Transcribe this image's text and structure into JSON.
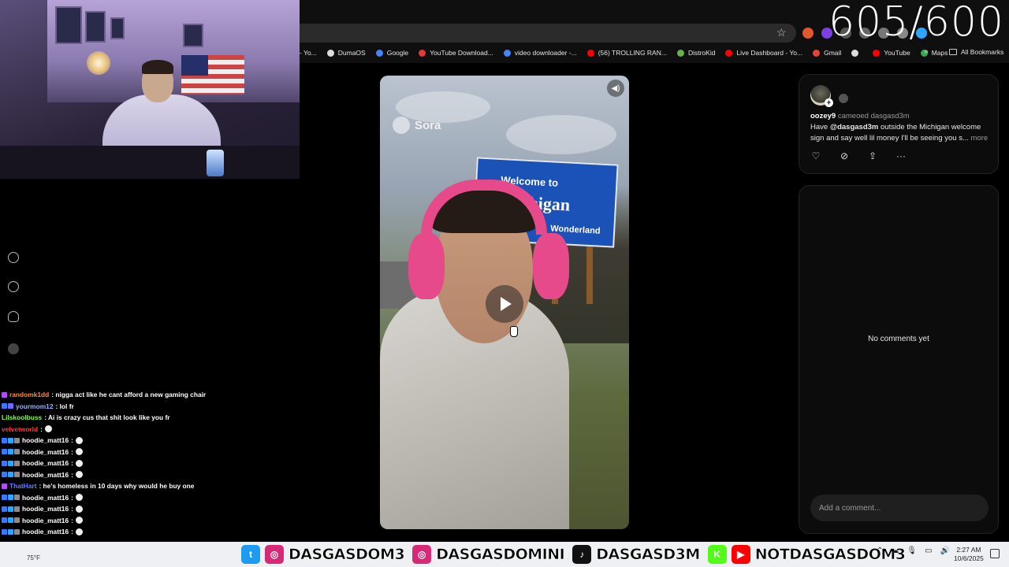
{
  "counter": "605/600",
  "bookmarks": [
    {
      "label": "- Yo...",
      "icon": "youtube-icon",
      "color": "#ff0000"
    },
    {
      "label": "DumaOS",
      "icon": "globe-icon",
      "color": "#dddddd"
    },
    {
      "label": "Google",
      "icon": "google-icon",
      "color": "#4285f4"
    },
    {
      "label": "YouTube Download...",
      "icon": "download-icon",
      "color": "#e53935"
    },
    {
      "label": "video downloader -...",
      "icon": "google-icon",
      "color": "#4285f4"
    },
    {
      "label": "(56) TROLLING RAN...",
      "icon": "youtube-icon",
      "color": "#ff0000"
    },
    {
      "label": "DistroKid",
      "icon": "distrokid-icon",
      "color": "#6ab04c"
    },
    {
      "label": "Live Dashboard - Yo...",
      "icon": "youtube-icon",
      "color": "#ff0000"
    },
    {
      "label": "Gmail",
      "icon": "gmail-icon",
      "color": "#ea4335"
    },
    {
      "label": "",
      "icon": "globe-icon",
      "color": "#dddddd"
    },
    {
      "label": "YouTube",
      "icon": "youtube-icon",
      "color": "#ff0000"
    },
    {
      "label": "Maps",
      "icon": "maps-icon",
      "color": "#34a853"
    }
  ],
  "bookmarks_more": "»",
  "all_bookmarks": "All Bookmarks",
  "video": {
    "watermark": "Sora",
    "sign_line1": "Welcome to",
    "sign_line2": "Michigan",
    "sign_line3": "Wonderland"
  },
  "post": {
    "username": "oozey9",
    "action": "cameoed dasgasd3m",
    "caption_mention": "@dasgasd3m",
    "caption_pre": "Have ",
    "caption_post": " outside the Michigan welcome sign and say well lil money I'll be seeing you s...",
    "more": "more"
  },
  "comments": {
    "empty": "No comments yet",
    "placeholder": "Add a comment..."
  },
  "chat": [
    {
      "user": "randomk1dd",
      "color": "#ff8a3d",
      "text": ": nigga act like he cant afford a new gaming chair",
      "badges": [
        "#b14ef5"
      ]
    },
    {
      "user": "yourmom12",
      "color": "#8fb4ff",
      "text": ": lol fr",
      "badges": [
        "#3b78ff",
        "#6b6bff"
      ]
    },
    {
      "user": "Lilskoolbuss",
      "color": "#7fff3a",
      "text": ": Ai is crazy cus that shit look like you fr",
      "badges": []
    },
    {
      "user": "velvetworld",
      "color": "#ff3b3b",
      "text": ":",
      "badges": [],
      "emote": true
    },
    {
      "user": "hoodie_matt16",
      "color": "#ffffff",
      "text": ":",
      "badges": [
        "#3b78ff",
        "#2ea6ff",
        "#8a8a8a"
      ],
      "emote": true
    },
    {
      "user": "hoodie_matt16",
      "color": "#ffffff",
      "text": ":",
      "badges": [
        "#3b78ff",
        "#2ea6ff",
        "#8a8a8a"
      ],
      "emote": true
    },
    {
      "user": "hoodie_matt16",
      "color": "#ffffff",
      "text": ":",
      "badges": [
        "#3b78ff",
        "#2ea6ff",
        "#8a8a8a"
      ],
      "emote": true
    },
    {
      "user": "hoodie_matt16",
      "color": "#ffffff",
      "text": ":",
      "badges": [
        "#3b78ff",
        "#2ea6ff",
        "#8a8a8a"
      ],
      "emote": true
    },
    {
      "user": "ThatHart",
      "color": "#6a7dff",
      "text": ": he's homeless in 10 days why would he buy one",
      "badges": [
        "#b14ef5"
      ]
    },
    {
      "user": "hoodie_matt16",
      "color": "#ffffff",
      "text": ":",
      "badges": [
        "#3b78ff",
        "#2ea6ff",
        "#8a8a8a"
      ],
      "emote": true
    },
    {
      "user": "hoodie_matt16",
      "color": "#ffffff",
      "text": ":",
      "badges": [
        "#3b78ff",
        "#2ea6ff",
        "#8a8a8a"
      ],
      "emote": true
    },
    {
      "user": "hoodie_matt16",
      "color": "#ffffff",
      "text": ":",
      "badges": [
        "#3b78ff",
        "#2ea6ff",
        "#8a8a8a"
      ],
      "emote": true
    },
    {
      "user": "hoodie_matt16",
      "color": "#ffffff",
      "text": ":",
      "badges": [
        "#3b78ff",
        "#2ea6ff",
        "#8a8a8a"
      ],
      "emote": true
    }
  ],
  "socials": [
    {
      "icon": "twitter-icon",
      "handle": "DASGASDOM3",
      "color": "#1d9bf0",
      "glyph": "t"
    },
    {
      "icon": "instagram-icon",
      "handle": "DASGASDOMINI",
      "color": "#d62976",
      "glyph": "◎"
    },
    {
      "icon": "tiktok-icon",
      "handle": "DASGASD3M",
      "color": "#111111",
      "glyph": "♪"
    },
    {
      "icon": "kick-icon",
      "handle": "NOTDASGASDOM3",
      "color": "#53fc18",
      "glyph": "K"
    }
  ],
  "socials_extra_icon": "youtube-icon",
  "taskbar": {
    "weather": "75°F",
    "time": "2:27 AM",
    "date": "10/6/2025"
  }
}
